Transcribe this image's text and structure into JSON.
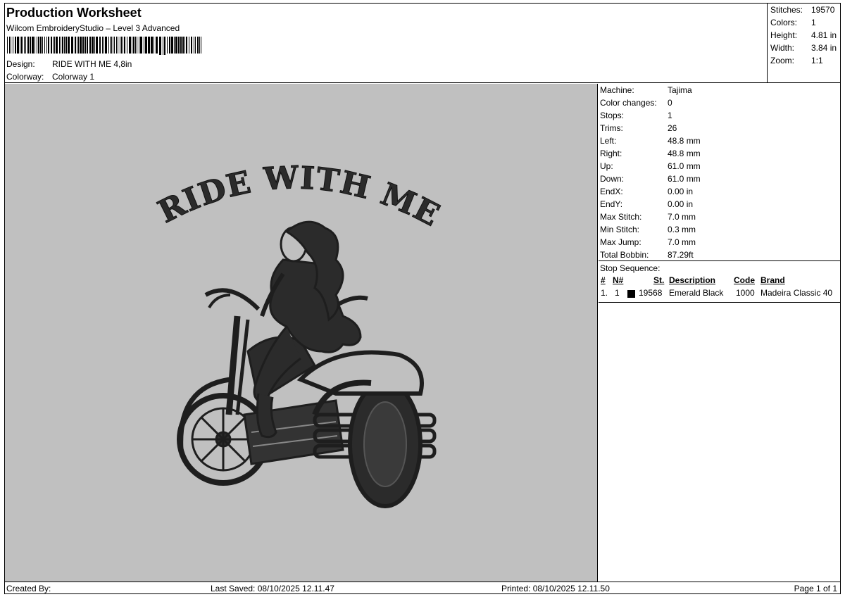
{
  "header": {
    "title": "Production Worksheet",
    "subtitle": "Wilcom EmbroideryStudio – Level 3 Advanced",
    "design_label": "Design:",
    "design_value": "RIDE WITH ME 4,8in",
    "colorway_label": "Colorway:",
    "colorway_value": "Colorway 1"
  },
  "summary": [
    {
      "label": "Stitches:",
      "value": "19570"
    },
    {
      "label": "Colors:",
      "value": "1"
    },
    {
      "label": "Height:",
      "value": "4.81 in"
    },
    {
      "label": "Width:",
      "value": "3.84 in"
    },
    {
      "label": "Zoom:",
      "value": "1:1"
    }
  ],
  "preview": {
    "design_text": "RIDE WITH ME",
    "thread_color": "#2b2b2b",
    "background_color": "#c0c0c0"
  },
  "machine": [
    {
      "label": "Machine:",
      "value": "Tajima"
    },
    {
      "label": "Color changes:",
      "value": "0"
    },
    {
      "label": "Stops:",
      "value": "1"
    },
    {
      "label": "Trims:",
      "value": "26"
    },
    {
      "label": "Left:",
      "value": "48.8 mm"
    },
    {
      "label": "Right:",
      "value": "48.8 mm"
    },
    {
      "label": "Up:",
      "value": "61.0 mm"
    },
    {
      "label": "Down:",
      "value": "61.0 mm"
    },
    {
      "label": "EndX:",
      "value": "0.00 in"
    },
    {
      "label": "EndY:",
      "value": "0.00 in"
    },
    {
      "label": "Max Stitch:",
      "value": "7.0 mm"
    },
    {
      "label": "Min Stitch:",
      "value": "0.3 mm"
    },
    {
      "label": "Max Jump:",
      "value": "7.0 mm"
    },
    {
      "label": "Total Bobbin:",
      "value": "87.29ft"
    }
  ],
  "stop_sequence": {
    "title": "Stop Sequence:",
    "columns": [
      "#",
      "N#",
      "St.",
      "Description",
      "Code",
      "Brand"
    ],
    "rows": [
      {
        "index": "1.",
        "needle": "1",
        "stitches": "19568",
        "description": "Emerald Black",
        "code": "1000",
        "brand": "Madeira Classic 40",
        "swatch_color": "#000000"
      }
    ]
  },
  "footer": {
    "created_by": "Created By:",
    "last_saved": "Last Saved: 08/10/2025 12.11.47",
    "printed": "Printed: 08/10/2025 12.11.50",
    "page": "Page 1 of 1"
  }
}
